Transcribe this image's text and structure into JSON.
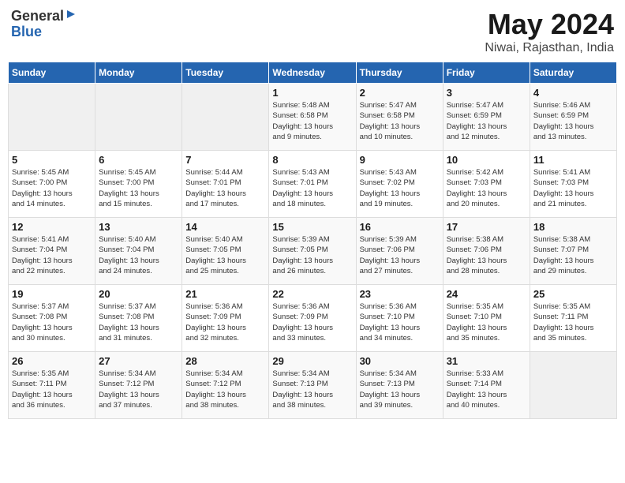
{
  "header": {
    "logo_general": "General",
    "logo_blue": "Blue",
    "title": "May 2024",
    "subtitle": "Niwai, Rajasthan, India"
  },
  "weekdays": [
    "Sunday",
    "Monday",
    "Tuesday",
    "Wednesday",
    "Thursday",
    "Friday",
    "Saturday"
  ],
  "weeks": [
    [
      {
        "day": "",
        "info": ""
      },
      {
        "day": "",
        "info": ""
      },
      {
        "day": "",
        "info": ""
      },
      {
        "day": "1",
        "info": "Sunrise: 5:48 AM\nSunset: 6:58 PM\nDaylight: 13 hours\nand 9 minutes."
      },
      {
        "day": "2",
        "info": "Sunrise: 5:47 AM\nSunset: 6:58 PM\nDaylight: 13 hours\nand 10 minutes."
      },
      {
        "day": "3",
        "info": "Sunrise: 5:47 AM\nSunset: 6:59 PM\nDaylight: 13 hours\nand 12 minutes."
      },
      {
        "day": "4",
        "info": "Sunrise: 5:46 AM\nSunset: 6:59 PM\nDaylight: 13 hours\nand 13 minutes."
      }
    ],
    [
      {
        "day": "5",
        "info": "Sunrise: 5:45 AM\nSunset: 7:00 PM\nDaylight: 13 hours\nand 14 minutes."
      },
      {
        "day": "6",
        "info": "Sunrise: 5:45 AM\nSunset: 7:00 PM\nDaylight: 13 hours\nand 15 minutes."
      },
      {
        "day": "7",
        "info": "Sunrise: 5:44 AM\nSunset: 7:01 PM\nDaylight: 13 hours\nand 17 minutes."
      },
      {
        "day": "8",
        "info": "Sunrise: 5:43 AM\nSunset: 7:01 PM\nDaylight: 13 hours\nand 18 minutes."
      },
      {
        "day": "9",
        "info": "Sunrise: 5:43 AM\nSunset: 7:02 PM\nDaylight: 13 hours\nand 19 minutes."
      },
      {
        "day": "10",
        "info": "Sunrise: 5:42 AM\nSunset: 7:03 PM\nDaylight: 13 hours\nand 20 minutes."
      },
      {
        "day": "11",
        "info": "Sunrise: 5:41 AM\nSunset: 7:03 PM\nDaylight: 13 hours\nand 21 minutes."
      }
    ],
    [
      {
        "day": "12",
        "info": "Sunrise: 5:41 AM\nSunset: 7:04 PM\nDaylight: 13 hours\nand 22 minutes."
      },
      {
        "day": "13",
        "info": "Sunrise: 5:40 AM\nSunset: 7:04 PM\nDaylight: 13 hours\nand 24 minutes."
      },
      {
        "day": "14",
        "info": "Sunrise: 5:40 AM\nSunset: 7:05 PM\nDaylight: 13 hours\nand 25 minutes."
      },
      {
        "day": "15",
        "info": "Sunrise: 5:39 AM\nSunset: 7:05 PM\nDaylight: 13 hours\nand 26 minutes."
      },
      {
        "day": "16",
        "info": "Sunrise: 5:39 AM\nSunset: 7:06 PM\nDaylight: 13 hours\nand 27 minutes."
      },
      {
        "day": "17",
        "info": "Sunrise: 5:38 AM\nSunset: 7:06 PM\nDaylight: 13 hours\nand 28 minutes."
      },
      {
        "day": "18",
        "info": "Sunrise: 5:38 AM\nSunset: 7:07 PM\nDaylight: 13 hours\nand 29 minutes."
      }
    ],
    [
      {
        "day": "19",
        "info": "Sunrise: 5:37 AM\nSunset: 7:08 PM\nDaylight: 13 hours\nand 30 minutes."
      },
      {
        "day": "20",
        "info": "Sunrise: 5:37 AM\nSunset: 7:08 PM\nDaylight: 13 hours\nand 31 minutes."
      },
      {
        "day": "21",
        "info": "Sunrise: 5:36 AM\nSunset: 7:09 PM\nDaylight: 13 hours\nand 32 minutes."
      },
      {
        "day": "22",
        "info": "Sunrise: 5:36 AM\nSunset: 7:09 PM\nDaylight: 13 hours\nand 33 minutes."
      },
      {
        "day": "23",
        "info": "Sunrise: 5:36 AM\nSunset: 7:10 PM\nDaylight: 13 hours\nand 34 minutes."
      },
      {
        "day": "24",
        "info": "Sunrise: 5:35 AM\nSunset: 7:10 PM\nDaylight: 13 hours\nand 35 minutes."
      },
      {
        "day": "25",
        "info": "Sunrise: 5:35 AM\nSunset: 7:11 PM\nDaylight: 13 hours\nand 35 minutes."
      }
    ],
    [
      {
        "day": "26",
        "info": "Sunrise: 5:35 AM\nSunset: 7:11 PM\nDaylight: 13 hours\nand 36 minutes."
      },
      {
        "day": "27",
        "info": "Sunrise: 5:34 AM\nSunset: 7:12 PM\nDaylight: 13 hours\nand 37 minutes."
      },
      {
        "day": "28",
        "info": "Sunrise: 5:34 AM\nSunset: 7:12 PM\nDaylight: 13 hours\nand 38 minutes."
      },
      {
        "day": "29",
        "info": "Sunrise: 5:34 AM\nSunset: 7:13 PM\nDaylight: 13 hours\nand 38 minutes."
      },
      {
        "day": "30",
        "info": "Sunrise: 5:34 AM\nSunset: 7:13 PM\nDaylight: 13 hours\nand 39 minutes."
      },
      {
        "day": "31",
        "info": "Sunrise: 5:33 AM\nSunset: 7:14 PM\nDaylight: 13 hours\nand 40 minutes."
      },
      {
        "day": "",
        "info": ""
      }
    ]
  ]
}
